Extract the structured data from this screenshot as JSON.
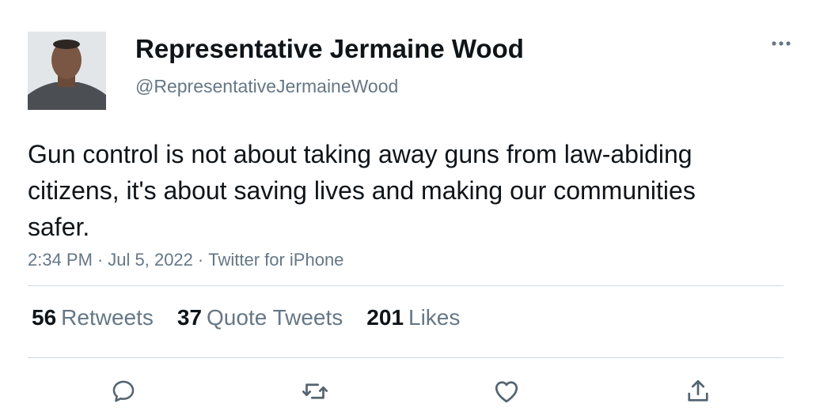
{
  "author": {
    "display_name": "Representative Jermaine Wood",
    "handle": "@RepresentativeJermaineWood"
  },
  "tweet": {
    "text": "Gun control is not about taking away guns from law-abiding citizens, it's about saving lives and making our communities safer.",
    "time": "2:34 PM",
    "date": "Jul 5, 2022",
    "source": "Twitter for iPhone"
  },
  "stats": {
    "retweets_count": "56",
    "retweets_label": "Retweets",
    "quotes_count": "37",
    "quotes_label": "Quote Tweets",
    "likes_count": "201",
    "likes_label": "Likes"
  },
  "icons": {
    "more": "more-horizontal-icon",
    "reply": "reply-bubble-icon",
    "retweet": "retweet-icon",
    "like": "heart-icon",
    "share": "share-icon"
  },
  "colors": {
    "text": "#0f1419",
    "secondary": "#657786",
    "divider": "#cfd9de"
  }
}
